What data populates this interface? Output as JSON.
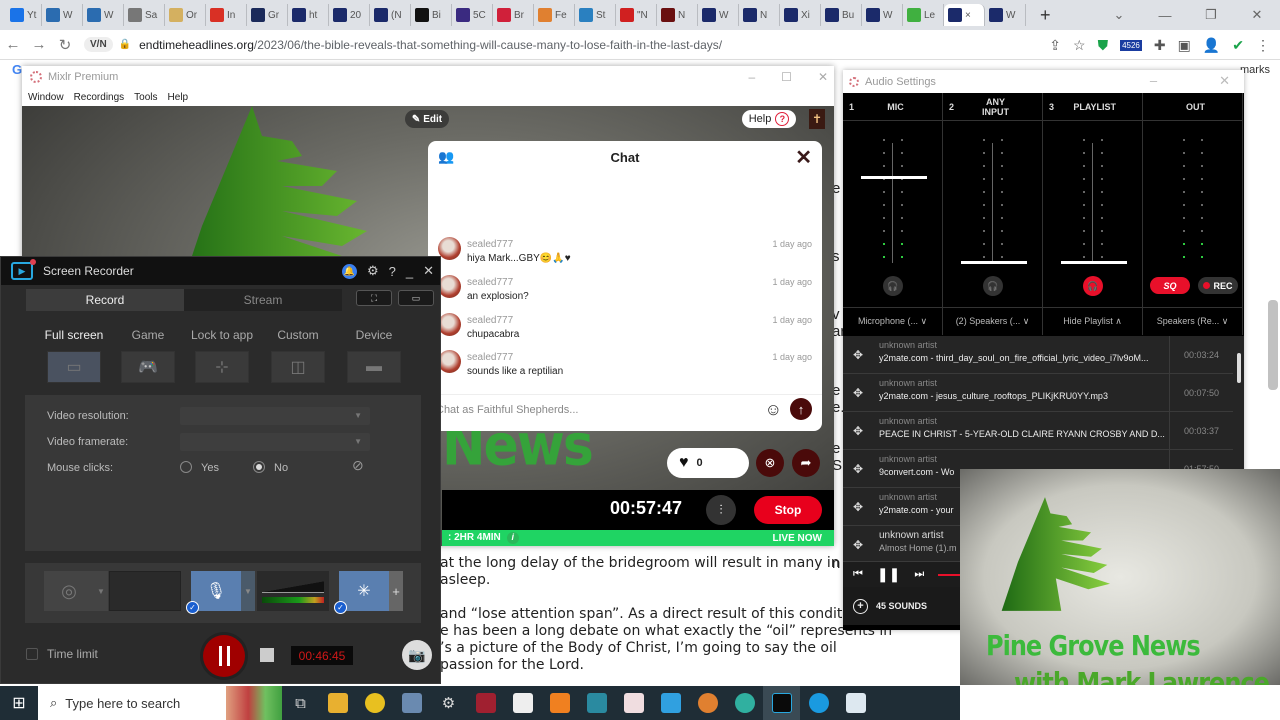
{
  "browser": {
    "tabs": [
      {
        "label": "Yt",
        "color": "#1a73e8"
      },
      {
        "label": "W",
        "color": "#2b6cb0"
      },
      {
        "label": "W",
        "color": "#2b6cb0"
      },
      {
        "label": "Sa",
        "color": "#777"
      },
      {
        "label": "Or",
        "color": "#d4b060"
      },
      {
        "label": "In",
        "color": "#d93025"
      },
      {
        "label": "Gr",
        "color": "#1b2a5a"
      },
      {
        "label": "ht",
        "color": "#1b2a6a"
      },
      {
        "label": "20",
        "color": "#1b2a6a"
      },
      {
        "label": "(N",
        "color": "#1b2a6a"
      },
      {
        "label": "Bi",
        "color": "#111"
      },
      {
        "label": "5C",
        "color": "#3a2a80"
      },
      {
        "label": "Br",
        "color": "#d0203a"
      },
      {
        "label": "Fe",
        "color": "#e08030"
      },
      {
        "label": "St",
        "color": "#2a80c0"
      },
      {
        "label": "\"N",
        "color": "#d02020"
      },
      {
        "label": "N",
        "color": "#6a1010"
      },
      {
        "label": "W",
        "color": "#1b2a6a"
      },
      {
        "label": "N",
        "color": "#1b2a6a"
      },
      {
        "label": "Xi",
        "color": "#1b2a6a"
      },
      {
        "label": "Bu",
        "color": "#1b2a6a"
      },
      {
        "label": "W",
        "color": "#1b2a6a"
      },
      {
        "label": "Le",
        "color": "#40b040"
      },
      {
        "label": "×",
        "color": "#1b2a6a",
        "active": true
      },
      {
        "label": "W",
        "color": "#1b2a6a"
      }
    ],
    "new_tab": "+",
    "url_domain": "endtimeheadlines.org",
    "url_path": "/2023/06/the-bible-reveals-that-something-will-cause-many-to-lose-faith-in-the-last-days/",
    "vpn_label": "V/N",
    "extension_badge": "4526",
    "bookmarks_fragment": "marks"
  },
  "article": {
    "lines": [
      "at the long delay of the bridegroom will result in many in t",
      "asleep.",
      "",
      "and “lose attention span”. As a direct result of this condition,",
      "e has been a long debate on what exactly the “oil” represents in",
      "’s a picture of the Body of Christ, I’m going to say the oil",
      "passion for the Lord."
    ],
    "side_fragments": [
      "e",
      "s",
      "v",
      "ar",
      "e",
      "e.",
      "e",
      "S",
      "n"
    ]
  },
  "mixlr": {
    "title": "Mixlr Premium",
    "menu": [
      "Window",
      "Recordings",
      "Tools",
      "Help"
    ],
    "edit_label": "Edit",
    "help_label": "Help",
    "chat": {
      "title": "Chat",
      "messages": [
        {
          "user": "sealed777",
          "time": "1 day ago",
          "text": "hiya Mark...GBY😊🙏♥"
        },
        {
          "user": "sealed777",
          "time": "1 day ago",
          "text": "an explosion?"
        },
        {
          "user": "sealed777",
          "time": "1 day ago",
          "text": "chupacabra"
        },
        {
          "user": "sealed777",
          "time": "1 day ago",
          "text": "sounds like a reptilian"
        }
      ],
      "input_placeholder": "Chat as Faithful Shepherds..."
    },
    "likes": "0",
    "broadcast_timer": "00:57:47",
    "stop_label": "Stop",
    "duration_label": ": 2HR 4MIN",
    "live_label": "LIVE NOW",
    "background_text": "News"
  },
  "recorder": {
    "title": "Screen Recorder",
    "tabs": [
      "Record",
      "Stream"
    ],
    "modes": [
      "Full screen",
      "Game",
      "Lock to app",
      "Custom",
      "Device"
    ],
    "active_mode": "Full screen",
    "settings": {
      "video_resolution_label": "Video resolution:",
      "video_framerate_label": "Video framerate:",
      "mouse_clicks_label": "Mouse clicks:",
      "yes_label": "Yes",
      "no_label": "No",
      "mouse_clicks_value": "No"
    },
    "time_limit_label": "Time limit",
    "elapsed": "00:46:45"
  },
  "audio": {
    "title": "Audio Settings",
    "channels": [
      {
        "num": "1",
        "name": "MIC",
        "device": "Microphone (... ∨",
        "fader_level": 0.72,
        "meter_green": 2,
        "monitor_on": false
      },
      {
        "num": "2",
        "name": "ANY INPUT",
        "device": "(2) Speakers (... ∨",
        "fader_level": 0.0,
        "meter_green": 0,
        "monitor_on": false
      },
      {
        "num": "3",
        "name": "PLAYLIST",
        "device": "Hide Playlist  ∧",
        "fader_level": 0.0,
        "meter_green": 0,
        "monitor_on": true
      },
      {
        "num": "",
        "name": "OUT",
        "device": "Speakers (Re... ∨",
        "meter_green": 2
      }
    ],
    "sq_label": "SQ",
    "rec_label": "REC",
    "playlist": [
      {
        "artist": "unknown artist",
        "name": "y2mate.com - third_day_soul_on_fire_official_lyric_video_i7lv9oM...",
        "duration": "00:03:24"
      },
      {
        "artist": "unknown artist",
        "name": "y2mate.com - jesus_culture_rooftops_PLIKjKRU0YY.mp3",
        "duration": "00:07:50"
      },
      {
        "artist": "unknown artist",
        "name": "PEACE IN CHRIST - 5-YEAR-OLD CLAIRE RYANN CROSBY AND D...",
        "duration": "00:03:37"
      },
      {
        "artist": "unknown artist",
        "name": "9convert.com - Wo",
        "duration": "01:57:50"
      },
      {
        "artist": "unknown artist",
        "name": "y2mate.com - your",
        "duration": ""
      },
      {
        "artist": "unknown artist",
        "name": "Almost Home (1).m",
        "duration": "",
        "current": true
      }
    ],
    "sounds_label": "45 SOUNDS"
  },
  "webcam": {
    "line1": "Pine Grove News",
    "line2": "with Mark Lawrence"
  },
  "taskbar": {
    "search_placeholder": "Type here to search"
  }
}
